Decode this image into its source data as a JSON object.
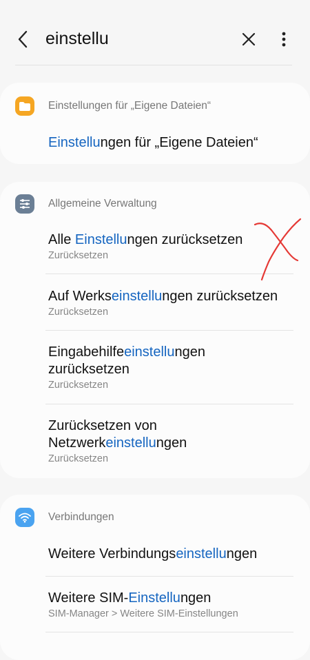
{
  "search": {
    "query": "einstellu"
  },
  "icons": {
    "back": "back-arrow-icon",
    "clear": "close-icon",
    "more": "more-vert-icon"
  },
  "colors": {
    "highlight": "#1565c0",
    "files_icon": "#f5a623",
    "admin_icon": "#6b7f95",
    "wifi_icon": "#4aa3f0",
    "annotation": "#e53935"
  },
  "sections": [
    {
      "category": "Einstellungen für „Eigene Dateien“",
      "items": [
        {
          "pre": "",
          "hl": "Einstellu",
          "post": "ngen für „Eigene Dateien“"
        }
      ]
    },
    {
      "category": "Allgemeine Verwaltung",
      "items": [
        {
          "pre": "Alle ",
          "hl": "Einstellu",
          "post": "ngen zurücksetzen",
          "sub": "Zurücksetzen"
        },
        {
          "pre": "Auf Werks",
          "hl": "einstellu",
          "post": "ngen zurücksetzen",
          "sub": "Zurücksetzen"
        },
        {
          "pre": "Eingabehilfe",
          "hl": "einstellu",
          "post": "ngen",
          "line2": "zurücksetzen",
          "sub": "Zurücksetzen"
        },
        {
          "pre": "Zurücksetzen von",
          "pre2": "Netzwerk",
          "hl": "einstellu",
          "post": "ngen",
          "sub": "Zurücksetzen"
        }
      ]
    },
    {
      "category": "Verbindungen",
      "items": [
        {
          "pre": "Weitere Verbindungs",
          "hl": "einstellu",
          "post": "ngen"
        },
        {
          "pre": "Weitere SIM-",
          "hl": "Einstellu",
          "post": "ngen",
          "sub": "SIM-Manager > Weitere SIM-Einstellungen"
        }
      ]
    }
  ]
}
